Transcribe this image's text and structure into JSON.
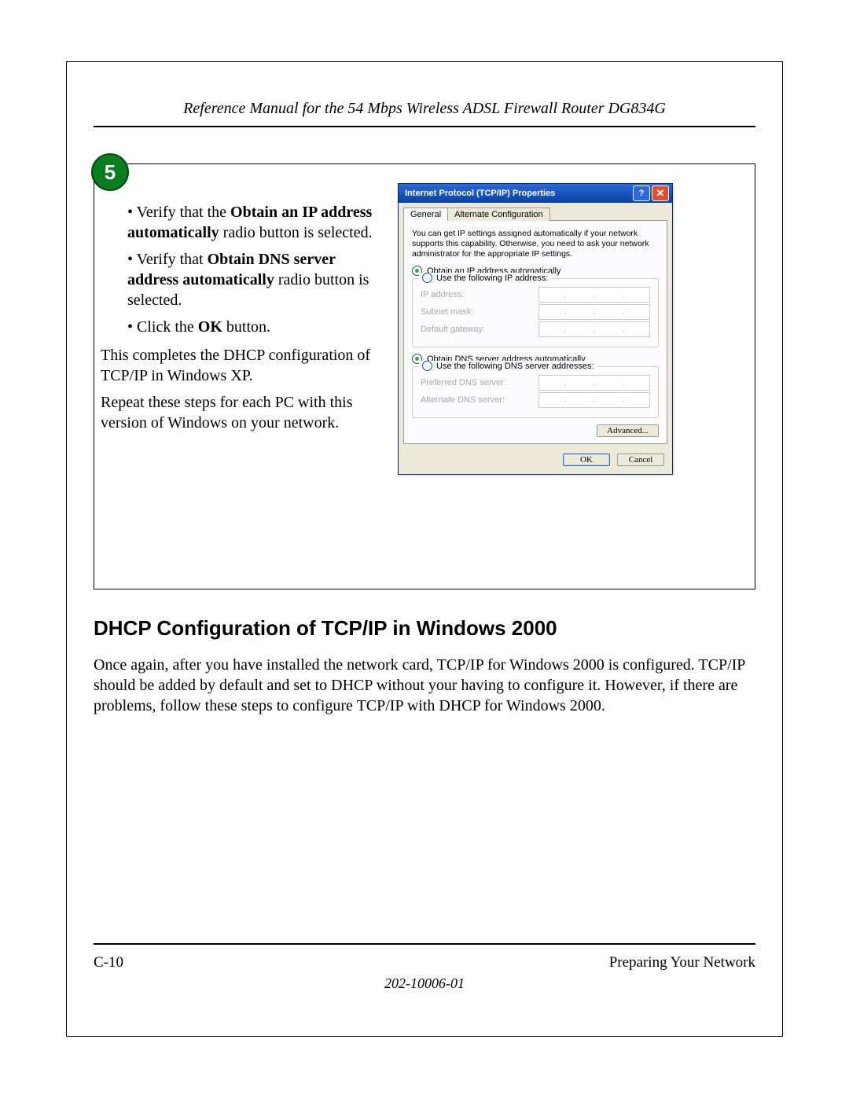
{
  "header": {
    "title": "Reference Manual for the 54 Mbps Wireless ADSL Firewall Router DG834G"
  },
  "step": {
    "number": "5",
    "bullet1_pre": "• Verify that the ",
    "bullet1_bold": "Obtain an IP address automatically",
    "bullet1_post": " radio button is selected.",
    "bullet2_pre": "• Verify that ",
    "bullet2_bold": "Obtain DNS server address automatically",
    "bullet2_post": " radio button is selected.",
    "bullet3_pre": "• Click the ",
    "bullet3_bold": "OK",
    "bullet3_post": " button.",
    "para1": "This completes the DHCP configuration of TCP/IP in Windows XP.",
    "para2": "Repeat these steps for each PC with this version of Windows on your network."
  },
  "dialog": {
    "title": "Internet Protocol (TCP/IP) Properties",
    "help_icon": "?",
    "close_icon": "✕",
    "tab_general": "General",
    "tab_alt": "Alternate Configuration",
    "desc": "You can get IP settings assigned automatically if your network supports this capability. Otherwise, you need to ask your network administrator for the appropriate IP settings.",
    "opt_auto_ip": "Obtain an IP address automatically",
    "opt_static_ip": "Use the following IP address:",
    "lbl_ip": "IP address:",
    "lbl_mask": "Subnet mask:",
    "lbl_gw": "Default gateway:",
    "opt_auto_dns": "Obtain DNS server address automatically",
    "opt_static_dns": "Use the following DNS server addresses:",
    "lbl_pdns": "Preferred DNS server:",
    "lbl_adns": "Alternate DNS server:",
    "btn_adv": "Advanced...",
    "btn_ok": "OK",
    "btn_cancel": "Cancel",
    "ip_dot": "."
  },
  "section": {
    "heading": "DHCP Configuration of TCP/IP in Windows 2000",
    "body": "Once again, after you have installed the network card, TCP/IP for Windows 2000 is configured. TCP/IP should be added by default and set to DHCP without your having to configure it. However, if there are problems, follow these steps to configure TCP/IP with DHCP for Windows 2000."
  },
  "footer": {
    "left": "C-10",
    "right": "Preparing Your Network",
    "doc": "202-10006-01"
  }
}
